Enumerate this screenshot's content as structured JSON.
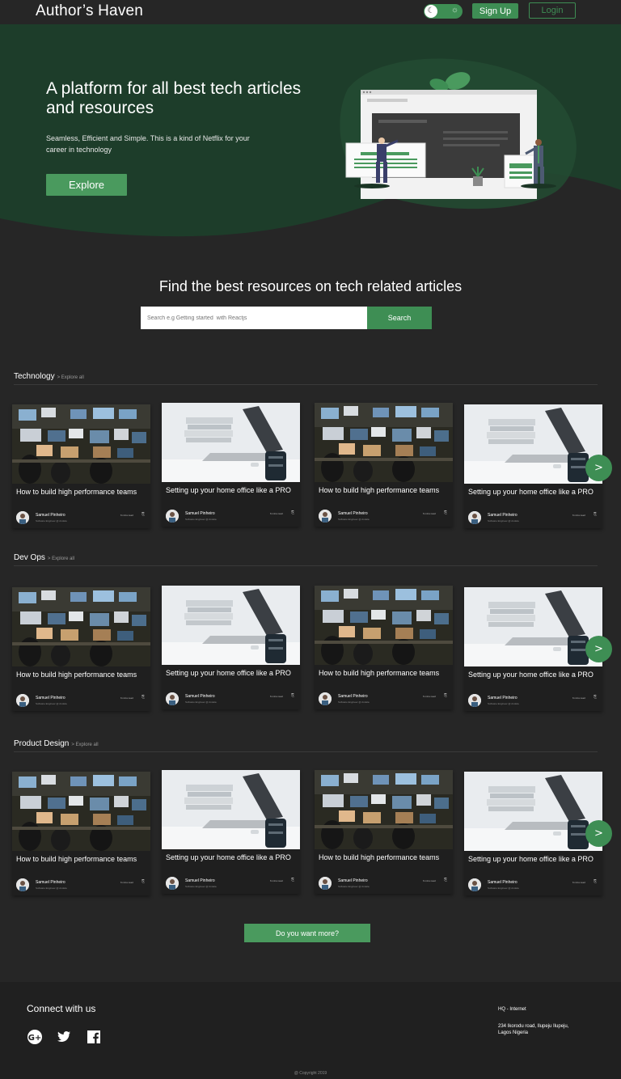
{
  "header": {
    "logo": "Author’s Haven",
    "signup": "Sign Up",
    "login": "Login"
  },
  "hero": {
    "title": "A platform for all best tech articles and resources",
    "subtitle": "Seamless, Efficient and Simple. This is a kind of Netflix for your career in technology",
    "cta": "Explore"
  },
  "search": {
    "title": "Find the best resources on tech related  articles",
    "placeholder": "Search e.g Getting started  with Reactjs",
    "button": "Search"
  },
  "sections": [
    {
      "name": "Technology",
      "explore": "> Explore all",
      "cards": [
        {
          "title": "How  to build high performance teams",
          "author": "Samuel Pinheiro",
          "role": "Software Engineer @ Andela",
          "read": "6 mins read",
          "image": "office-monitors"
        },
        {
          "title": "Setting up your home office like a PRO",
          "author": "Samuel Pinheiro",
          "role": "Software Engineer @ Andela",
          "read": "6 mins read",
          "image": "laptop-desk"
        },
        {
          "title": "How  to build high performance teams",
          "author": "Samuel Pinheiro",
          "role": "Software Engineer @ Andela",
          "read": "6 mins read",
          "image": "office-monitors"
        },
        {
          "title": "Setting up your home office like a PRO",
          "author": "Samuel Pinheiro",
          "role": "Software Engineer @ Andela",
          "read": "6 mins read",
          "image": "laptop-desk"
        }
      ]
    },
    {
      "name": "Dev Ops",
      "explore": "> Explore all",
      "cards": [
        {
          "title": "How  to build high performance teams",
          "author": "Samuel Pinheiro",
          "role": "Software Engineer @ Andela",
          "read": "6 mins read",
          "image": "office-monitors"
        },
        {
          "title": "Setting up your home office like a PRO",
          "author": "Samuel Pinheiro",
          "role": "Software Engineer @ Andela",
          "read": "6 mins read",
          "image": "laptop-desk"
        },
        {
          "title": "How  to build high performance teams",
          "author": "Samuel Pinheiro",
          "role": "Software Engineer @ Andela",
          "read": "6 mins read",
          "image": "office-monitors"
        },
        {
          "title": "Setting up your home office like a PRO",
          "author": "Samuel Pinheiro",
          "role": "Software Engineer @ Andela",
          "read": "6 mins read",
          "image": "laptop-desk"
        }
      ]
    },
    {
      "name": "Product Design",
      "explore": "> Explore all",
      "cards": [
        {
          "title": "How  to build high performance teams",
          "author": "Samuel Pinheiro",
          "role": "Software Engineer @ Andela",
          "read": "6 mins read",
          "image": "office-monitors"
        },
        {
          "title": "Setting up your home office like a PRO",
          "author": "Samuel Pinheiro",
          "role": "Software Engineer @ Andela",
          "read": "6 mins read",
          "image": "laptop-desk"
        },
        {
          "title": "How  to build high performance teams",
          "author": "Samuel Pinheiro",
          "role": "Software Engineer @ Andela",
          "read": "6 mins read",
          "image": "office-monitors"
        },
        {
          "title": "Setting up your home office like a PRO",
          "author": "Samuel Pinheiro",
          "role": "Software Engineer @ Andela",
          "read": "6 mins read",
          "image": "laptop-desk"
        }
      ]
    }
  ],
  "next_icon": ">",
  "more_button": "Do you want more?",
  "footer": {
    "connect": "Connect with us",
    "social": [
      "google-plus-icon",
      "twitter-icon",
      "facebook-icon"
    ],
    "hq": "HQ - Internet",
    "address": "234 Ikorodu road, Ilupeju Ilupeju, Lagos Nigeria",
    "copyright": "@ Copyright 2019"
  },
  "colors": {
    "background": "#262626",
    "hero_green": "#1d3d2a",
    "accent": "#3e8e54",
    "card": "#1f1f1f"
  }
}
